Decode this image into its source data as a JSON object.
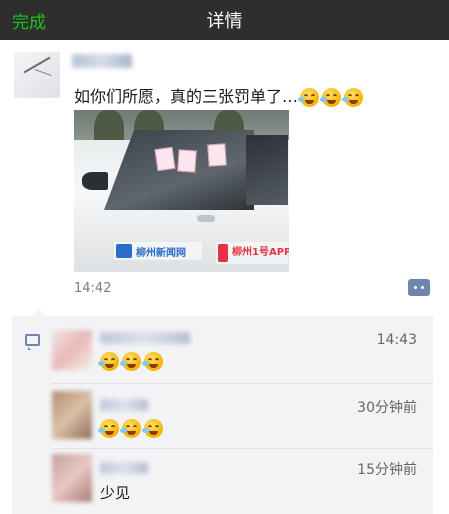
{
  "header": {
    "done_label": "完成",
    "title": "详情"
  },
  "post": {
    "text": "如你们所愿，真的三张罚单了…",
    "emoji_count": 3,
    "emoji_icon": "laugh-cry-icon",
    "time": "14:42",
    "watermarks": {
      "left": "柳州新闻网",
      "right": "柳州1号APP"
    }
  },
  "comments": [
    {
      "time": "14:43",
      "body": "",
      "emoji_count": 3,
      "emoji_icon": "laugh-cry-icon"
    },
    {
      "time": "30分钟前",
      "body": "",
      "emoji_count": 3,
      "emoji_icon": "tears-of-joy-icon"
    },
    {
      "time": "15分钟前",
      "body": "少见",
      "emoji_count": 0
    }
  ],
  "colors": {
    "header_bg": "#2e2e2e",
    "done_green": "#1ec21e",
    "link_blue": "#6e86ad",
    "panel_bg": "#f3f3f5"
  }
}
